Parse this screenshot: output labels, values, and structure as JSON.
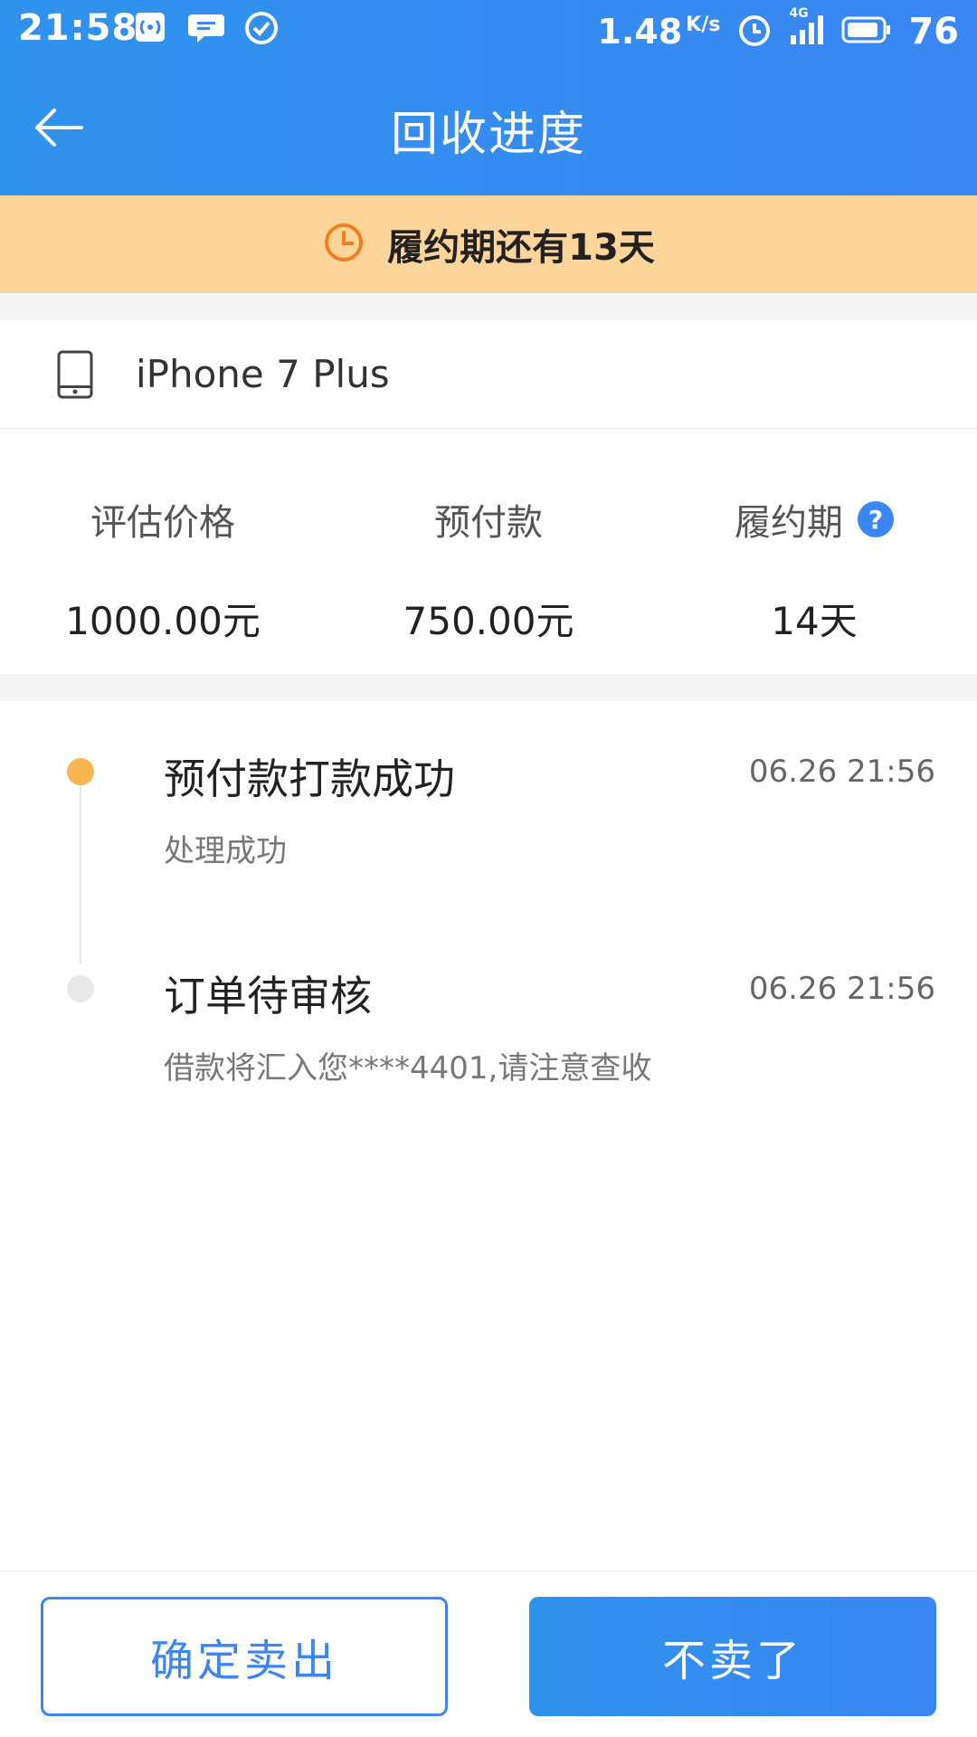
{
  "status_bar": {
    "time": "21:58",
    "speed_value": "1.48",
    "speed_unit": "K/s",
    "network": "4G",
    "battery": "76",
    "icons": [
      "hotspot-icon",
      "message-icon",
      "check-icon",
      "alarm-icon",
      "signal-icon",
      "battery-icon"
    ]
  },
  "header": {
    "title": "回收进度"
  },
  "notice": {
    "text": "履约期还有13天",
    "icon": "clock-icon",
    "color": "#fdd59b"
  },
  "device": {
    "name": "iPhone 7 Plus",
    "icon": "phone-icon"
  },
  "stats": [
    {
      "label": "评估价格",
      "value": "1000.00元"
    },
    {
      "label": "预付款",
      "value": "750.00元"
    },
    {
      "label": "履约期",
      "value": "14天",
      "help_icon": "?"
    }
  ],
  "timeline": [
    {
      "title": "预付款打款成功",
      "time": "06.26 21:56",
      "desc": "处理成功",
      "status": "active"
    },
    {
      "title": "订单待审核",
      "time": "06.26 21:56",
      "desc": "借款将汇入您****4401,请注意查收",
      "status": "inactive"
    }
  ],
  "actions": {
    "confirm_label": "确定卖出",
    "cancel_label": "不卖了"
  },
  "colors": {
    "primary": "#3a86f4",
    "notice_bg": "#fdd59b",
    "timeline_active": "#f9b552",
    "timeline_inactive": "#e8e8e8"
  }
}
